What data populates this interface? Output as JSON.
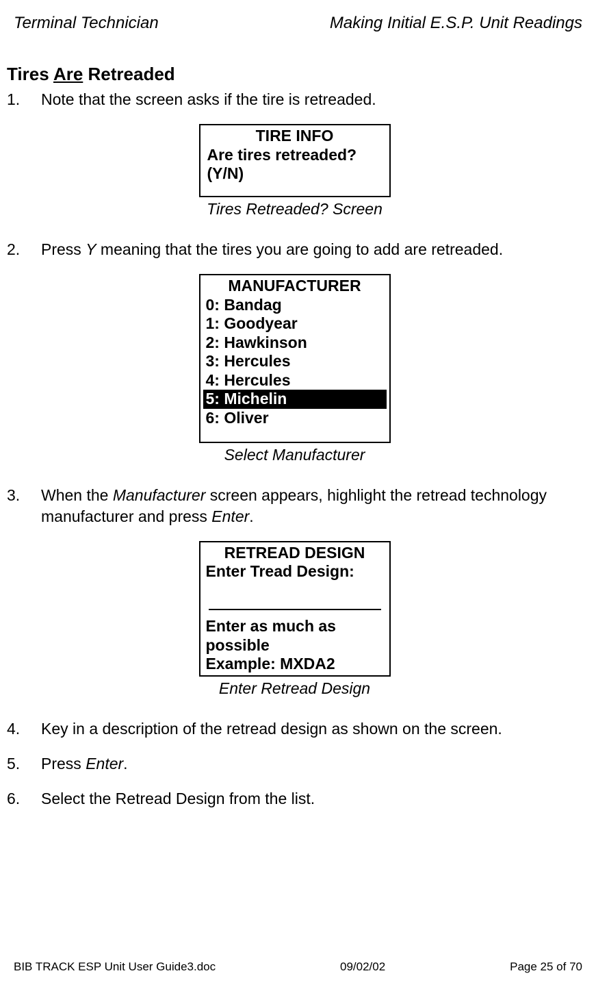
{
  "header": {
    "left": "Terminal Technician",
    "right": "Making Initial E.S.P. Unit Readings"
  },
  "section_title": {
    "pre": "Tires ",
    "underlined": "Are",
    "post": " Retreaded"
  },
  "steps": {
    "s1": {
      "num": "1.",
      "text": "Note that the screen asks if the tire is retreaded."
    },
    "s2": {
      "num": "2.",
      "pre": "Press ",
      "key": "Y",
      "mid": " meaning",
      "post": " that the tires you are going to add are retreaded."
    },
    "s3": {
      "num": "3.",
      "pre": "When the ",
      "ital1": "Manufacturer",
      "mid": " screen appears, highlight the retread technology manufacturer and press ",
      "ital2": "Enter",
      "post": "."
    },
    "s4": {
      "num": "4.",
      "text": "Key in a description of the retread design as shown on the screen."
    },
    "s5": {
      "num": "5.",
      "pre": "Press ",
      "ital": "Enter",
      "post": "."
    },
    "s6": {
      "num": "6.",
      "text": "Select the Retread Design from the list."
    }
  },
  "screen1": {
    "title": "TIRE INFO",
    "line1": "Are tires retreaded?",
    "line2": "(Y/N)",
    "caption": "Tires Retreaded? Screen"
  },
  "screen2": {
    "title": "MANUFACTURER",
    "opts": {
      "o0": "0: Bandag",
      "o1": "1: Goodyear",
      "o2": "2: Hawkinson",
      "o3": "3: Hercules",
      "o4": "4: Hercules",
      "o5": "5: Michelin",
      "o6": "6: Oliver"
    },
    "caption": "Select Manufacturer"
  },
  "screen3": {
    "title": "RETREAD DESIGN",
    "prompt": "Enter Tread Design:",
    "hint1": "Enter as much as",
    "hint2": " possible",
    "hint3": "Example: MXDA2",
    "caption": "Enter Retread Design"
  },
  "footer": {
    "left": "BIB TRACK  ESP Unit User Guide3.doc",
    "center": "09/02/02",
    "right": "Page 25 of 70"
  }
}
